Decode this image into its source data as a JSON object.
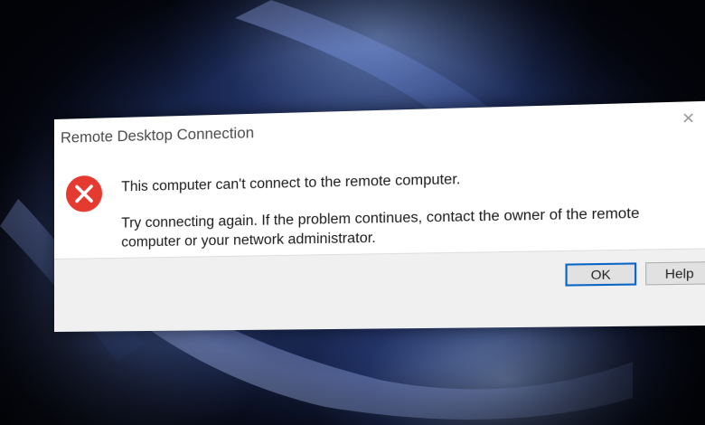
{
  "dialog": {
    "title": "Remote Desktop Connection",
    "close_glyph": "✕",
    "icon": "error-icon",
    "message_main": "This computer can't connect to the remote computer.",
    "message_detail": "Try connecting again. If the problem continues, contact the owner of the remote computer or your network administrator.",
    "ok_label": "OK",
    "help_label": "Help"
  },
  "colors": {
    "error_red": "#e53a2f",
    "ok_border": "#0a66c4"
  }
}
